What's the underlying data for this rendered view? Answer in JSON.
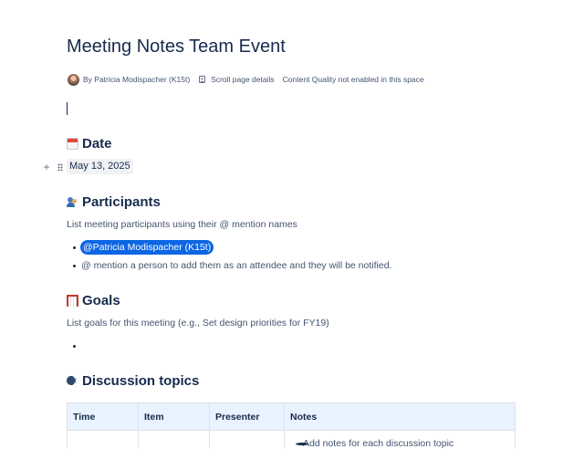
{
  "page": {
    "title": "Meeting Notes Team Event"
  },
  "meta": {
    "author": "By Patricia Modispacher (K15t)",
    "scroll_details": "Scroll page details",
    "content_quality": "Content Quality not enabled in this space"
  },
  "sections": {
    "date": {
      "heading": "Date",
      "icon": "calendar-icon",
      "value": "May 13, 2025"
    },
    "participants": {
      "heading": "Participants",
      "icon": "people-icon",
      "description": "List meeting participants using their @ mention names",
      "mention": "@Patricia Modispacher (K15t)",
      "hint": "@ mention a person to add them as an attendee and they will be notified."
    },
    "goals": {
      "heading": "Goals",
      "icon": "goal-net-icon",
      "description": "List goals for this meeting (e.g., Set design priorities for FY19)"
    },
    "discussion": {
      "heading": "Discussion topics",
      "icon": "speaking-head-icon",
      "table": {
        "columns": [
          "Time",
          "Item",
          "Presenter",
          "Notes"
        ],
        "rows": [
          [
            "",
            "",
            "",
            "Add notes for each discussion topic"
          ]
        ]
      }
    }
  },
  "colors": {
    "mention_bg": "#0c66e4",
    "table_header_bg": "#e9f2ff",
    "text_primary": "#172b4d",
    "text_secondary": "#44546f"
  }
}
